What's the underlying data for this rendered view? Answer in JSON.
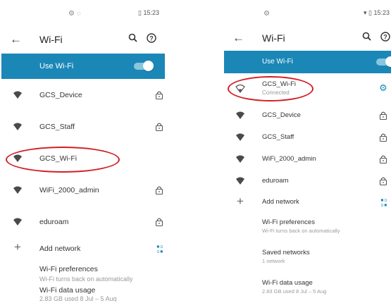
{
  "left": {
    "status": {
      "left_icons": "⚙ ◌",
      "time": "15:23",
      "battery_icon": "battery-icon"
    },
    "title": "Wi-Fi",
    "toggle_label": "Use Wi-Fi",
    "networks": [
      "GCS_Device",
      "GCS_Staff",
      "GCS_Wi-Fi",
      "WiFi_2000_admin",
      "eduroam"
    ],
    "add_network": "Add network",
    "prefs": [
      {
        "title": "Wi-Fi preferences",
        "sub": "Wi-Fi turns back on automatically"
      },
      {
        "title": "Wi-Fi data usage",
        "sub": "2.83 GB used 8 Jul – 5 Aug"
      }
    ]
  },
  "right": {
    "status": {
      "left_icons": "⚙",
      "time": "15:23",
      "wifi_icon": "wifi-icon",
      "battery_icon": "battery-icon"
    },
    "title": "Wi-Fi",
    "toggle_label": "Use Wi-Fi",
    "connected": {
      "name": "GCS_Wi-Fi",
      "status": "Connected"
    },
    "networks": [
      "GCS_Device",
      "GCS_Staff",
      "WiFi_2000_admin",
      "eduroam"
    ],
    "add_network": "Add network",
    "prefs": [
      {
        "title": "Wi-Fi preferences",
        "sub": "Wi-Fi turns back on automatically"
      },
      {
        "title": "Saved networks",
        "sub": "1 network"
      },
      {
        "title": "Wi-Fi data usage",
        "sub": "2.83 GB used 8 Jul – 5 Aug"
      }
    ]
  },
  "colors": {
    "accent": "#1b87b7",
    "highlight_ring": "#d21f24"
  },
  "icons": {
    "back": "←",
    "search": "⚲",
    "help": "?",
    "lock": "lock-icon",
    "gear": "⚙",
    "plus": "+",
    "qr": "qr-code-icon"
  }
}
